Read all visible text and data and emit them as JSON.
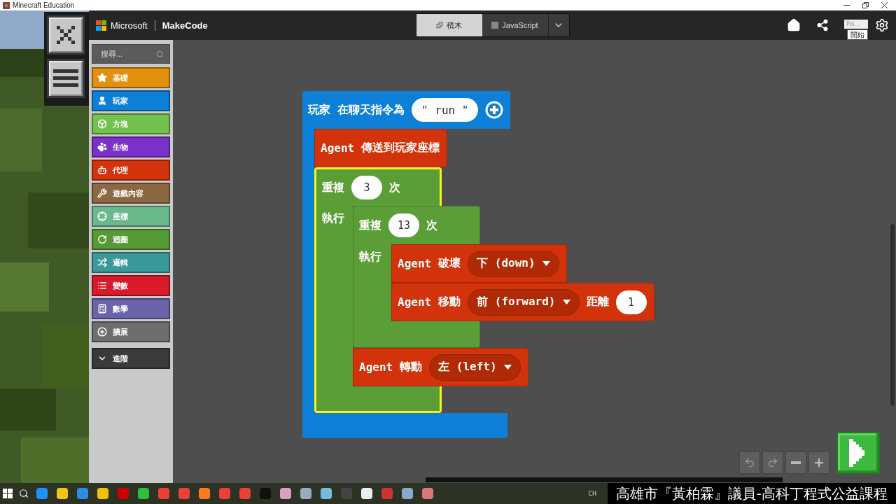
{
  "window": {
    "title": "Minecraft Education"
  },
  "header": {
    "brand": "Microsoft",
    "product": "MakeCode",
    "tabs": [
      {
        "label": "積木",
        "kind": "blocks",
        "selected": true
      },
      {
        "label": "JavaScript",
        "kind": "js",
        "selected": false
      }
    ],
    "tooltip": {
      "name": "Poi...",
      "action": "開始"
    }
  },
  "toolbox": {
    "search": {
      "placeholder": "搜尋..."
    },
    "categories": [
      {
        "label": "基礎",
        "kind": "star",
        "color": "#e3900c"
      },
      {
        "label": "玩家",
        "kind": "user",
        "color": "#0d7fd6"
      },
      {
        "label": "方塊",
        "kind": "cube",
        "color": "#73c24d"
      },
      {
        "label": "生物",
        "kind": "paw",
        "color": "#7b30c9"
      },
      {
        "label": "代理",
        "kind": "agent",
        "color": "#d2330a"
      },
      {
        "label": "遊戲內容",
        "kind": "wrench",
        "color": "#8b6842"
      },
      {
        "label": "座標",
        "kind": "target",
        "color": "#69b98c"
      },
      {
        "label": "迴圈",
        "kind": "loop",
        "color": "#569a36"
      },
      {
        "label": "邏輯",
        "kind": "shuffle",
        "color": "#3a9a9a"
      },
      {
        "label": "變數",
        "kind": "list",
        "color": "#d81a2a"
      },
      {
        "label": "數學",
        "kind": "calc",
        "color": "#6a63a8"
      },
      {
        "label": "擴展",
        "kind": "plus",
        "color": "#6e6e6e"
      },
      {
        "label": "進階",
        "kind": "more",
        "color": "#3a3a3a"
      }
    ]
  },
  "workspace": {
    "blocks": [
      {
        "kind": "event",
        "parts": [
          {
            "kind": "text",
            "text": "玩家"
          },
          {
            "kind": "text",
            "text": "在聊天指令為"
          },
          {
            "kind": "string",
            "text": "\" run \""
          },
          {
            "kind": "add"
          }
        ],
        "children": [
          {
            "kind": "statement",
            "parts": [
              {
                "kind": "text",
                "text": "Agent"
              },
              {
                "kind": "text",
                "text": "傳送到玩家座標"
              }
            ]
          },
          {
            "kind": "repeat",
            "selected": true,
            "label": "執行",
            "parts": [
              {
                "kind": "text",
                "text": "重複"
              },
              {
                "kind": "number",
                "text": "3"
              },
              {
                "kind": "text",
                "text": "次"
              }
            ],
            "children": [
              {
                "kind": "repeat",
                "selected": false,
                "label": "執行",
                "parts": [
                  {
                    "kind": "text",
                    "text": "重複"
                  },
                  {
                    "kind": "number",
                    "text": "13"
                  },
                  {
                    "kind": "text",
                    "text": "次"
                  }
                ],
                "children": [
                  {
                    "kind": "statement",
                    "parts": [
                      {
                        "kind": "text",
                        "text": "Agent"
                      },
                      {
                        "kind": "text",
                        "text": "破壞"
                      },
                      {
                        "kind": "dropdown",
                        "text": "下 (down)"
                      }
                    ]
                  },
                  {
                    "kind": "statement",
                    "parts": [
                      {
                        "kind": "text",
                        "text": "Agent"
                      },
                      {
                        "kind": "text",
                        "text": "移動"
                      },
                      {
                        "kind": "dropdown",
                        "text": "前 (forward)"
                      },
                      {
                        "kind": "text",
                        "text": "距離"
                      },
                      {
                        "kind": "number",
                        "text": "1"
                      }
                    ]
                  }
                ]
              },
              {
                "kind": "statement",
                "parts": [
                  {
                    "kind": "text",
                    "text": "Agent"
                  },
                  {
                    "kind": "text",
                    "text": "轉動"
                  },
                  {
                    "kind": "dropdown",
                    "text": "左 (left)"
                  }
                ]
              }
            ]
          }
        ]
      }
    ]
  },
  "taskbar": {
    "tray": "CH"
  },
  "caption": "高雄市『黃柏霖』議員-高科丁程式公益課程"
}
